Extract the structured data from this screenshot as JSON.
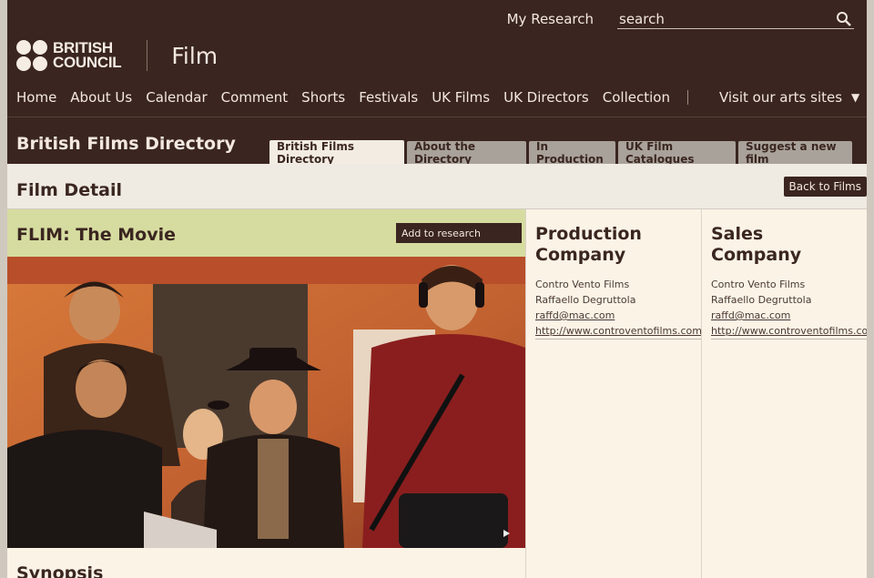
{
  "header": {
    "my_research": "My Research",
    "search_placeholder": "search",
    "logo_line1": "BRITISH",
    "logo_line2": "COUNCIL",
    "section_title": "Film"
  },
  "nav": {
    "items": [
      "Home",
      "About Us",
      "Calendar",
      "Comment",
      "Shorts",
      "Festivals",
      "UK Films",
      "UK Directors",
      "Collection"
    ],
    "arts_sites": "Visit our arts sites"
  },
  "directory": {
    "title": "British Films Directory",
    "tabs": [
      "British Films Directory",
      "About the Directory",
      "In Production",
      "UK Film Catalogues",
      "Suggest a new film"
    ],
    "active_tab": "British Films Directory"
  },
  "detail": {
    "title": "Film Detail",
    "back_label": "Back to Films"
  },
  "film": {
    "name": "FLIM: The Movie",
    "add_label": "Add to research",
    "synopsis_heading": "Synopsis"
  },
  "production": {
    "title_line1": "Production",
    "title_line2": "Company",
    "company": "Contro Vento Films",
    "contact": "Raffaello Degruttola",
    "email": "raffd@mac.com",
    "url": "http://www.controventofilms.com/fli"
  },
  "sales": {
    "title_line1": "Sales",
    "title_line2": "Company",
    "company": "Contro Vento Films",
    "contact": "Raffaello Degruttola",
    "email": "raffd@mac.com",
    "url": "http://www.controventofilms.com/fi"
  },
  "colors": {
    "header_bg": "#3a2520",
    "film_bar": "#d6dca0",
    "panel_bg": "#fbf3e6"
  }
}
